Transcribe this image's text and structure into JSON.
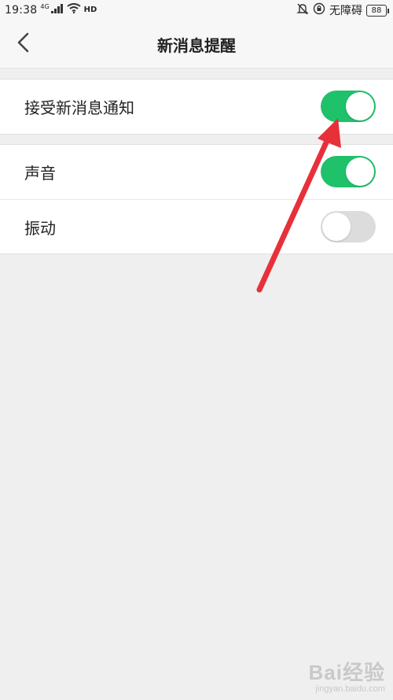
{
  "status_bar": {
    "time": "19:38",
    "network": "4G",
    "hd": "HD",
    "accessibility": "无障碍",
    "battery": "88",
    "icons": [
      "signal-icon",
      "wifi-icon",
      "alarm-off-icon",
      "lock-rotation-icon"
    ]
  },
  "nav": {
    "back_icon": "chevron-left-icon",
    "title": "新消息提醒"
  },
  "settings": {
    "receive_notifications": {
      "label": "接受新消息通知",
      "enabled": true
    },
    "sound": {
      "label": "声音",
      "enabled": true
    },
    "vibration": {
      "label": "振动",
      "enabled": false
    }
  },
  "colors": {
    "switch_on": "#1fc16b",
    "switch_off": "#dcdcdc",
    "annotation_arrow": "#e8303a",
    "background": "#efefef"
  },
  "watermark": {
    "brand": "Bai经验",
    "url": "jingyan.baidu.com"
  }
}
